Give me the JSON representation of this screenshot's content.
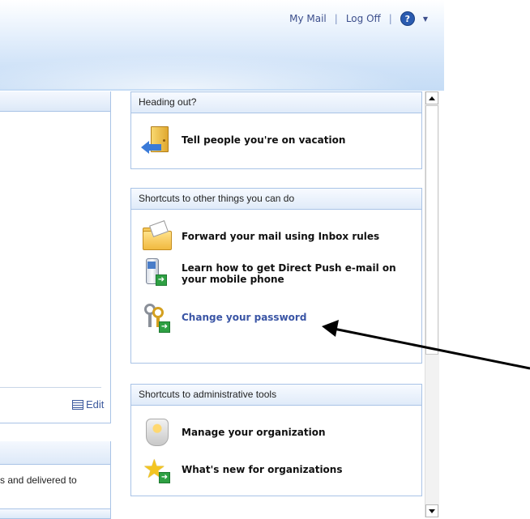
{
  "header": {
    "links": [
      {
        "label": "My Mail"
      },
      {
        "label": "Log Off"
      }
    ],
    "help_icon": "question-icon",
    "menu_icon": "caret-down-icon"
  },
  "left": {
    "edit_label": "Edit",
    "snippet": "s and delivered to"
  },
  "panels": {
    "heading_out": {
      "title": "Heading out?",
      "items": [
        {
          "label": "Tell people you're on vacation",
          "icon": "vacation-door-icon"
        }
      ]
    },
    "shortcuts": {
      "title": "Shortcuts to other things you can do",
      "items": [
        {
          "label": "Forward your mail using Inbox rules",
          "icon": "forward-folder-icon"
        },
        {
          "label_line1": "Learn how to get Direct Push e-mail on",
          "label_line2": "your mobile phone",
          "icon": "mobile-phone-icon"
        },
        {
          "label": "Change your password",
          "icon": "keys-icon"
        }
      ]
    },
    "admin": {
      "title": "Shortcuts to administrative tools",
      "items": [
        {
          "label": "Manage your organization",
          "icon": "organization-icon"
        },
        {
          "label": "What's new for organizations",
          "icon": "star-icon"
        }
      ]
    }
  },
  "colors": {
    "link": "#3a55a5",
    "panel_border": "#a9c3e6",
    "annotation": "#000000"
  }
}
